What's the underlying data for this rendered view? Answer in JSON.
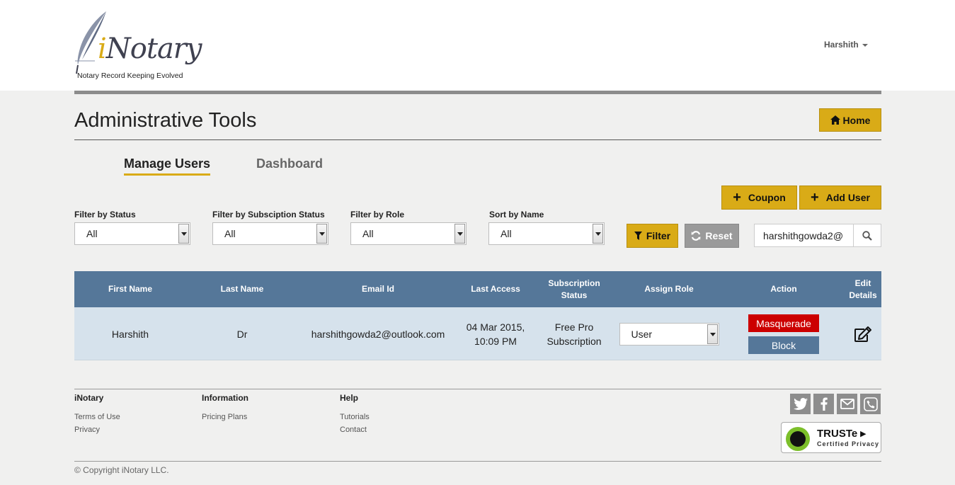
{
  "brand": {
    "name_prefix": "i",
    "name_rest": "Notary",
    "tagline": "Notary Record Keeping Evolved",
    "accent_color": "#d9ab17",
    "header_color": "#557799"
  },
  "user_menu": {
    "label": "Harshith"
  },
  "page": {
    "title": "Administrative Tools",
    "home_label": "Home"
  },
  "tabs": [
    {
      "label": "Manage Users",
      "active": true
    },
    {
      "label": "Dashboard",
      "active": false
    }
  ],
  "actions": {
    "coupon_label": "Coupon",
    "add_user_label": "Add User"
  },
  "filters": [
    {
      "label": "Filter by Status",
      "value": "All"
    },
    {
      "label": "Filter by Subsciption Status",
      "value": "All"
    },
    {
      "label": "Filter by Role",
      "value": "All"
    },
    {
      "label": "Sort by Name",
      "value": "All"
    }
  ],
  "filter_button": "Filter",
  "reset_button": "Reset",
  "search": {
    "value": "harshithgowda2@",
    "icon": "search-icon"
  },
  "table": {
    "headers": {
      "first_name": "First Name",
      "last_name": "Last Name",
      "email": "Email Id",
      "last_access": "Last Access",
      "subscription_1": "Subscription",
      "subscription_2": "Status",
      "assign_role": "Assign Role",
      "action": "Action",
      "edit_1": "Edit",
      "edit_2": "Details"
    },
    "rows": [
      {
        "first_name": "Harshith",
        "last_name": "Dr",
        "email": "harshithgowda2@outlook.com",
        "last_access_1": "04 Mar 2015,",
        "last_access_2": "10:09 PM",
        "subscription_1": "Free Pro",
        "subscription_2": "Subscription",
        "role": "User",
        "masquerade_label": "Masquerade",
        "block_label": "Block",
        "edit_icon": "edit-icon"
      }
    ]
  },
  "footer": {
    "col1": {
      "title": "iNotary",
      "links": [
        "Terms of Use",
        "Privacy"
      ]
    },
    "col2": {
      "title": "Information",
      "links": [
        "Pricing Plans"
      ]
    },
    "col3": {
      "title": "Help",
      "links": [
        "Tutorials",
        "Contact"
      ]
    },
    "social": [
      "twitter-icon",
      "facebook-icon",
      "email-icon",
      "phone-icon"
    ],
    "truste": {
      "name": "TRUSTe",
      "sub": "Certified Privacy"
    },
    "copyright": "© Copyright iNotary LLC."
  }
}
